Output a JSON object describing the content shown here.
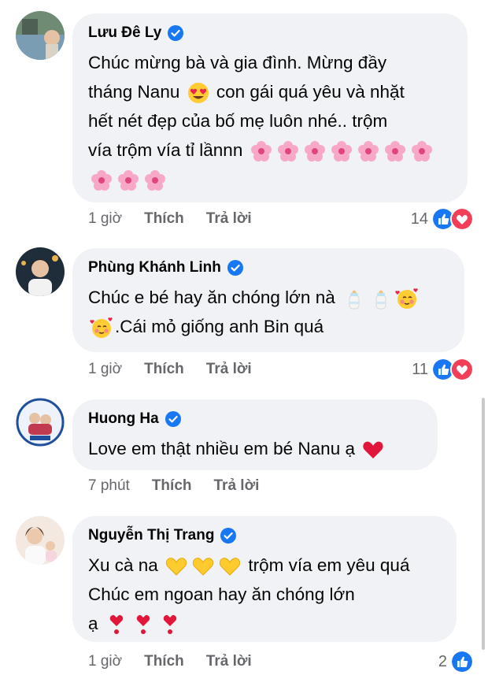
{
  "comments": [
    {
      "author": "Lưu Đê Ly",
      "text_lines": [
        "Chúc mừng bà và gia đình. Mừng đầy",
        "tháng Nanu",
        "con gái quá yêu và nhặt",
        "hết nét đẹp của bố mẹ luôn nhé.. trộm",
        "vía trộm vía tỉ lầnnn"
      ],
      "time": "1 giờ",
      "like_label": "Thích",
      "reply_label": "Trả lời",
      "reaction_count": "14",
      "reactions": [
        "like-icon",
        "love-icon"
      ]
    },
    {
      "author": "Phùng Khánh Linh",
      "text_lines": [
        "Chúc e bé hay ăn chóng lớn nà",
        ".Cái mỏ giống anh Bin quá"
      ],
      "time": "1 giờ",
      "like_label": "Thích",
      "reply_label": "Trả lời",
      "reaction_count": "11",
      "reactions": [
        "like-icon",
        "love-icon"
      ]
    },
    {
      "author": "Huong Ha",
      "text_lines": [
        "Love em thật nhiều em bé Nanu ạ"
      ],
      "time": "7 phút",
      "like_label": "Thích",
      "reply_label": "Trả lời"
    },
    {
      "author": "Nguyễn Thị Trang",
      "text_lines": [
        "Xu cà na",
        "trộm vía em yêu quá",
        "Chúc em ngoan hay ăn chóng lớn",
        "ạ"
      ],
      "time": "1 giờ",
      "like_label": "Thích",
      "reply_label": "Trả lời",
      "reaction_count": "2",
      "reactions": [
        "like-icon"
      ]
    }
  ],
  "colors": {
    "bubble": "#f0f2f5",
    "meta_text": "#65676b",
    "verified": "#1877f2",
    "like": "#1877f2",
    "love": "#f33e58"
  }
}
